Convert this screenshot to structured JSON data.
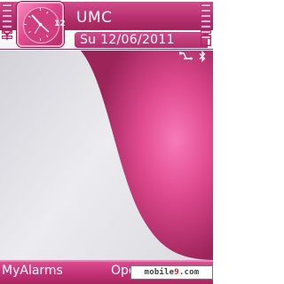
{
  "status_bar": {
    "operator": "UMC",
    "date": "Su 12/06/2011",
    "clock_numeral": "12",
    "icons": [
      "signal-antenna-icon",
      "battery-icon",
      "usb-connection-icon",
      "bluetooth-icon"
    ]
  },
  "softkeys": {
    "left_label": "MyAlarms",
    "right_label": "Ope"
  },
  "watermark": {
    "prefix": "mobile",
    "number": "9",
    "suffix": ".com"
  },
  "theme": {
    "accent": "#c2337a",
    "accent_light": "#f06aaa",
    "background_light": "#e0dfe5"
  }
}
